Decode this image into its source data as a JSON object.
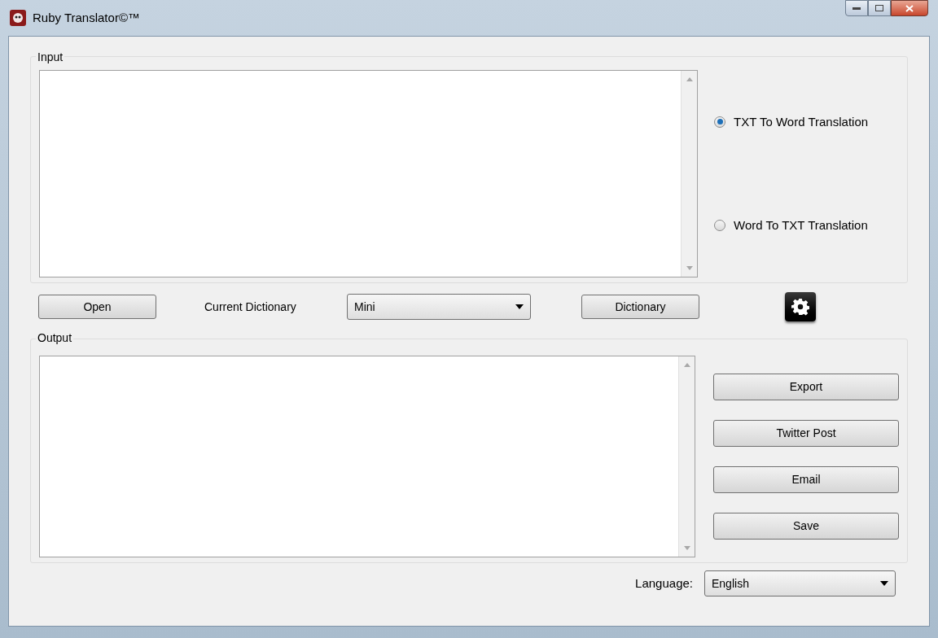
{
  "window": {
    "title": "Ruby Translator©™"
  },
  "input": {
    "label": "Input"
  },
  "modes": [
    {
      "label": "TXT To Word Translation",
      "selected": true
    },
    {
      "label": "Word To TXT Translation",
      "selected": false
    }
  ],
  "open_button": "Open",
  "dictionary": {
    "label": "Current Dictionary",
    "value": "Mini"
  },
  "dictionary_button": "Dictionary",
  "output": {
    "label": "Output"
  },
  "output_buttons": [
    "Export",
    "Twitter Post",
    "Email",
    "Save"
  ],
  "language": {
    "label": "Language:",
    "value": "English"
  }
}
